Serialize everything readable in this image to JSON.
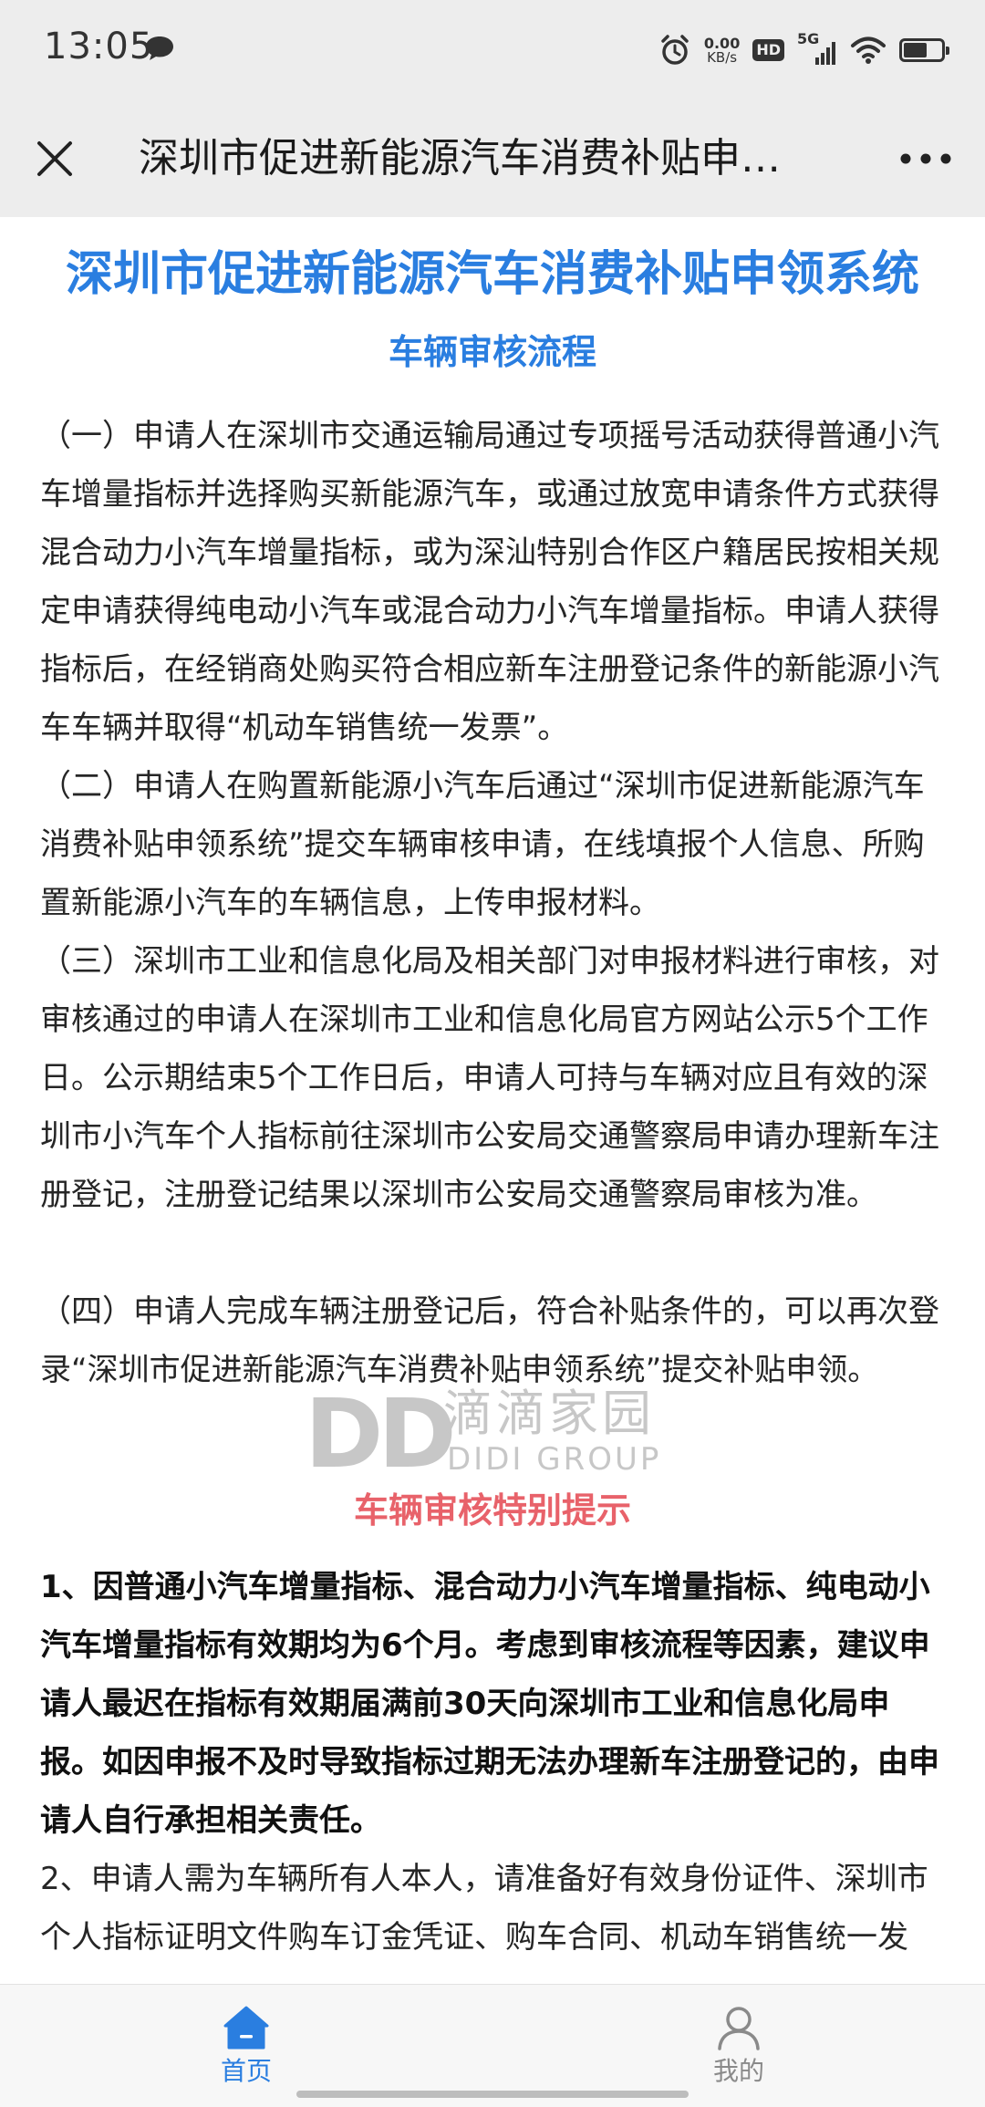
{
  "status_bar": {
    "time": "13:05",
    "net_speed_value": "0.00",
    "net_speed_unit": "KB/s",
    "hd_label": "HD",
    "network_label": "5G",
    "battery_level": 0.62,
    "icons": [
      "message-icon",
      "alarm-icon",
      "signal-icon",
      "wifi-icon",
      "battery-icon"
    ]
  },
  "nav": {
    "title": "深圳市促进新能源汽车消费补贴申…",
    "close_icon": "close-icon",
    "more_icon": "more-icon"
  },
  "page": {
    "main_title": "深圳市促进新能源汽车消费补贴申领系统",
    "sub_title": "车辆审核流程",
    "paragraphs": [
      "（一）申请人在深圳市交通运输局通过专项摇号活动获得普通小汽车增量指标并选择购买新能源汽车，或通过放宽申请条件方式获得混合动力小汽车增量指标，或为深汕特别合作区户籍居民按相关规定申请获得纯电动小汽车或混合动力小汽车增量指标。申请人获得指标后，在经销商处购买符合相应新车注册登记条件的新能源小汽车车辆并取得“机动车销售统一发票”。",
      "（二）申请人在购置新能源小汽车后通过“深圳市促进新能源汽车消费补贴申领系统”提交车辆审核申请，在线填报个人信息、所购置新能源小汽车的车辆信息，上传申报材料。",
      "（三）深圳市工业和信息化局及相关部门对申报材料进行审核，对审核通过的申请人在深圳市工业和信息化局官方网站公示5个工作日。公示期结束5个工作日后，申请人可持与车辆对应且有效的深圳市小汽车个人指标前往深圳市公安局交通警察局申请办理新车注册登记，注册登记结果以深圳市公安局交通警察局审核为准。",
      "（四）申请人完成车辆注册登记后，符合补贴条件的，可以再次登录“深圳市促进新能源汽车消费补贴申领系统”提交补贴申领。"
    ],
    "watermark": {
      "logo": "DD",
      "cn": "滴滴家园",
      "en": "DIDI GROUP"
    },
    "special_title": "车辆审核特别提示",
    "notes": [
      "1、因普通小汽车增量指标、混合动力小汽车增量指标、纯电动小汽车增量指标有效期均为6个月。考虑到审核流程等因素，建议申请人最迟在指标有效期届满前30天向深圳市工业和信息化局申报。如因申报不及时导致指标过期无法办理新车注册登记的，由申请人自行承担相关责任。",
      "2、申请人需为车辆所有人本人，请准备好有效身份证件、深圳市个人指标证明文件购车订金凭证、购车合同、机动车销售统一发"
    ]
  },
  "tabbar": {
    "items": [
      {
        "label": "首页",
        "icon": "home-icon",
        "active": true
      },
      {
        "label": "我的",
        "icon": "user-icon",
        "active": false
      }
    ]
  },
  "colors": {
    "accent": "#2a7ee0",
    "warning": "#e8626a",
    "bar_bg": "#ededed"
  }
}
